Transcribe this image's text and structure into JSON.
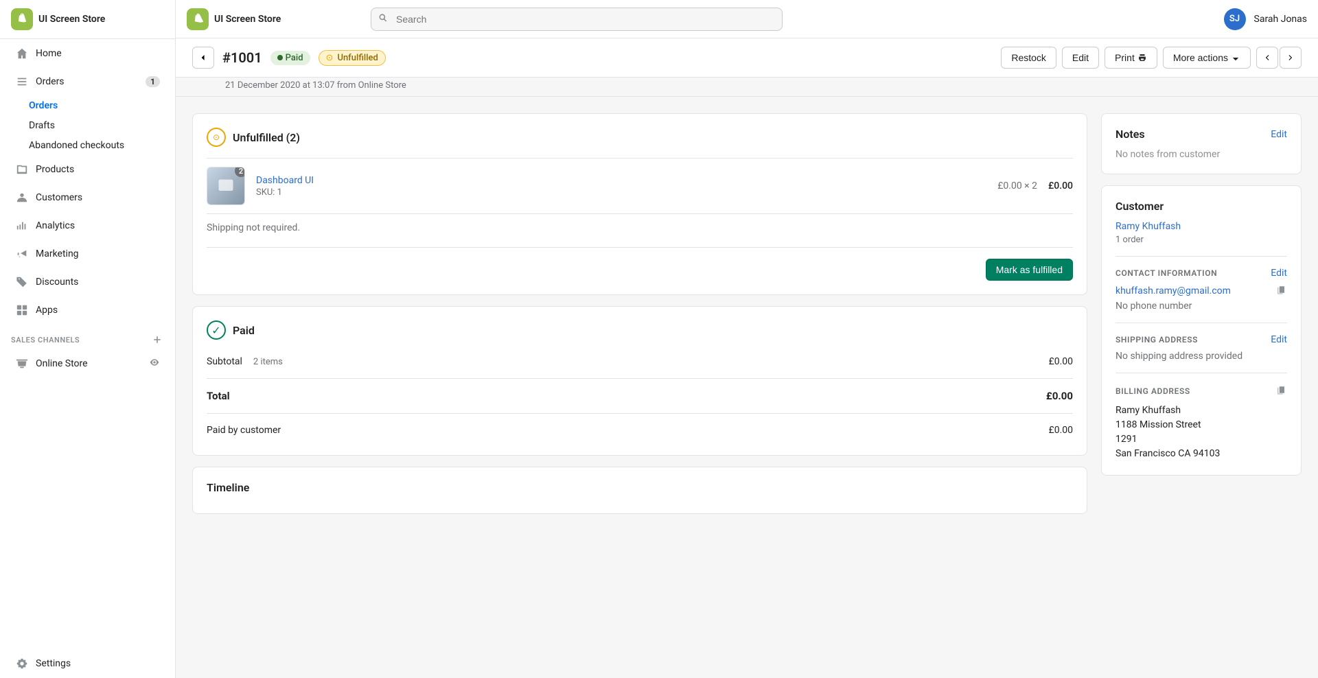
{
  "app": {
    "store_name": "UI Screen Store"
  },
  "topbar": {
    "search_placeholder": "Search",
    "user_initials": "SJ",
    "user_name": "Sarah Jonas"
  },
  "sidebar": {
    "nav_items": [
      {
        "id": "home",
        "label": "Home",
        "icon": "home",
        "badge": null,
        "active": false
      },
      {
        "id": "orders",
        "label": "Orders",
        "icon": "orders",
        "badge": "1",
        "active": true
      },
      {
        "id": "products",
        "label": "Products",
        "icon": "products",
        "badge": null,
        "active": false
      },
      {
        "id": "customers",
        "label": "Customers",
        "icon": "customers",
        "badge": null,
        "active": false
      },
      {
        "id": "analytics",
        "label": "Analytics",
        "icon": "analytics",
        "badge": null,
        "active": false
      },
      {
        "id": "marketing",
        "label": "Marketing",
        "icon": "marketing",
        "badge": null,
        "active": false
      },
      {
        "id": "discounts",
        "label": "Discounts",
        "icon": "discounts",
        "badge": null,
        "active": false
      },
      {
        "id": "apps",
        "label": "Apps",
        "icon": "apps",
        "badge": null,
        "active": false
      }
    ],
    "orders_sub": [
      {
        "id": "orders-list",
        "label": "Orders",
        "active": true
      },
      {
        "id": "drafts",
        "label": "Drafts",
        "active": false
      },
      {
        "id": "abandoned",
        "label": "Abandoned checkouts",
        "active": false
      }
    ],
    "sales_channels_label": "SALES CHANNELS",
    "sales_channels": [
      {
        "id": "online-store",
        "label": "Online Store",
        "icon": "store"
      }
    ],
    "settings_label": "Settings"
  },
  "page": {
    "back_label": "←",
    "order_number": "#1001",
    "badge_paid": "Paid",
    "badge_unfulfilled": "Unfulfilled",
    "order_date": "21 December 2020 at 13:07 from Online Store",
    "actions": {
      "restock": "Restock",
      "edit": "Edit",
      "print": "Print",
      "more_actions": "More actions"
    }
  },
  "unfulfilled": {
    "title": "Unfulfilled (2)",
    "product_name": "Dashboard UI",
    "product_sku": "SKU: 1",
    "product_qty": "2",
    "product_price": "£0.00 × 2",
    "product_total": "£0.00",
    "shipping_note": "Shipping not required.",
    "fulfill_btn": "Mark as fulfilled"
  },
  "payment": {
    "title": "Paid",
    "subtotal_label": "Subtotal",
    "subtotal_items": "2 items",
    "subtotal_amount": "£0.00",
    "total_label": "Total",
    "total_amount": "£0.00",
    "paid_by_label": "Paid by customer",
    "paid_by_amount": "£0.00"
  },
  "timeline": {
    "title": "Timeline"
  },
  "notes": {
    "title": "Notes",
    "edit_label": "Edit",
    "no_notes": "No notes from customer"
  },
  "customer": {
    "title": "Customer",
    "name": "Ramy Khuffash",
    "orders": "1 order",
    "contact_section": "CONTACT INFORMATION",
    "contact_edit": "Edit",
    "email": "khuffash.ramy@gmail.com",
    "phone": "No phone number",
    "shipping_section": "SHIPPING ADDRESS",
    "shipping_edit": "Edit",
    "shipping_no_data": "No shipping address provided",
    "billing_section": "BILLING ADDRESS",
    "billing_name": "Ramy Khuffash",
    "billing_street": "1188 Mission Street",
    "billing_apt": "1291",
    "billing_city": "San Francisco CA 94103"
  }
}
